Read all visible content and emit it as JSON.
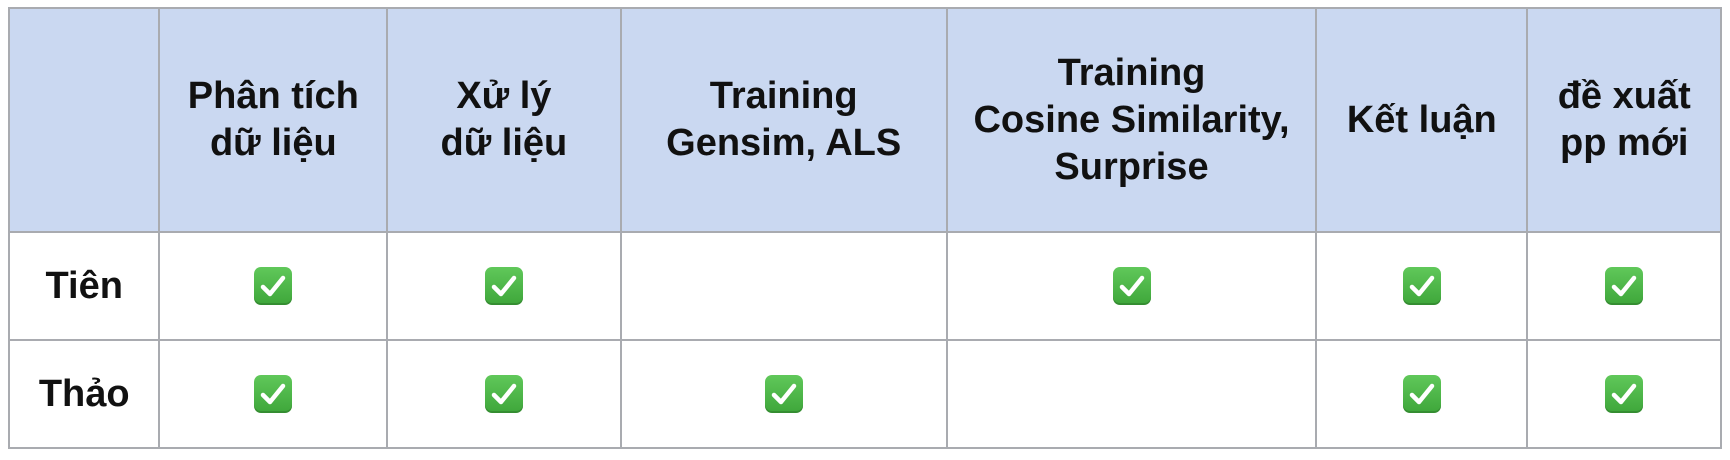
{
  "table": {
    "headers": [
      "",
      "Phân tích\ndữ liệu",
      "Xử lý\ndữ liệu",
      "Training\nGensim, ALS",
      "Training\nCosine Similarity,\nSurprise",
      "Kết luận",
      "đề xuất\npp mới"
    ],
    "rows": [
      {
        "name": "Tiên",
        "checks": [
          true,
          true,
          false,
          true,
          true,
          true
        ]
      },
      {
        "name": "Thảo",
        "checks": [
          true,
          true,
          true,
          false,
          true,
          true
        ]
      }
    ],
    "check_icon": "check-mark-button-icon",
    "colors": {
      "header_bg": "#cad8f1",
      "border": "#a9abb0",
      "check_green": "#4cb748"
    }
  }
}
